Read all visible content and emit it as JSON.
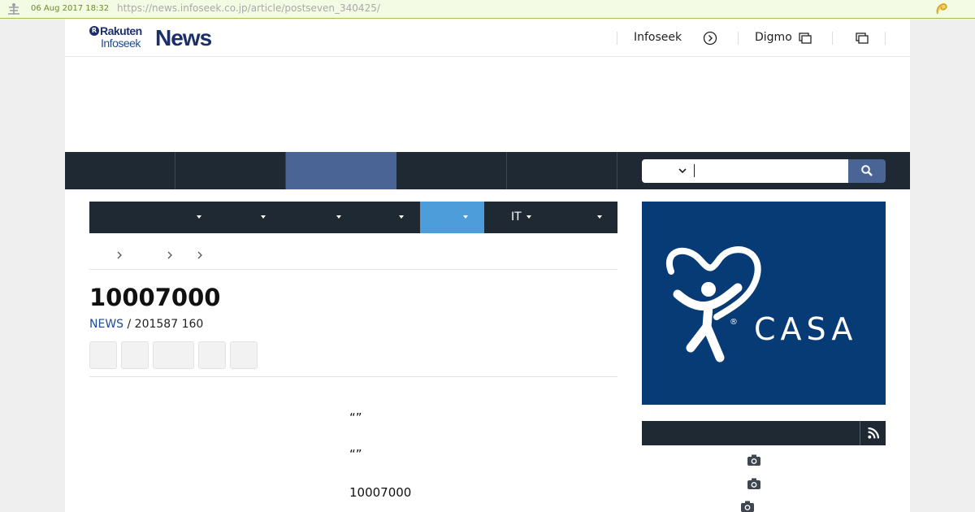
{
  "archive": {
    "date": "06 Aug 2017 18:32",
    "url": "https://news.infoseek.co.jp/article/postseven_340425/"
  },
  "header": {
    "brand_rakuten": "Rakuten",
    "brand_infoseek": "Infoseek",
    "brand_news": "News",
    "brand_mark": "R",
    "link_infoseek": "Infoseek",
    "link_digmo": "Digmo"
  },
  "sub_nav": {
    "it_label": "IT"
  },
  "article": {
    "title": "10007000",
    "source": "NEWS",
    "meta": " / 201587 160",
    "body": [
      "“”",
      "“”",
      "10007000"
    ]
  },
  "sidebar": {
    "ad_brand": "CASA",
    "ad_reg": "®"
  },
  "colors": {
    "nav_bg": "#1e2933",
    "nav_active": "#4a6595",
    "subnav_active": "#4e9ddb",
    "ad_bg": "#073b76",
    "link": "#1d4b94"
  },
  "icons": [
    "play-circle-icon",
    "window-icon",
    "chevron-down-icon",
    "search-icon",
    "chevron-right-icon",
    "rss-icon",
    "camera-icon",
    "wayback-logo-icon",
    "favorite-icon"
  ]
}
